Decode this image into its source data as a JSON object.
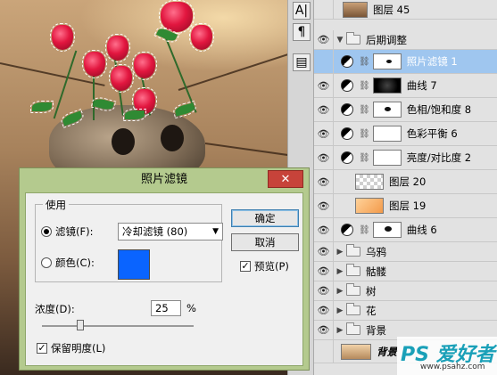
{
  "canvas": {
    "description_color": "#a7825c"
  },
  "toolstrip": {
    "tools": [
      {
        "icon": "char-A-icon",
        "glyph": "A|"
      },
      {
        "icon": "paragraph-icon",
        "glyph": "¶"
      },
      {
        "icon": "panel-icon",
        "glyph": "▤"
      }
    ]
  },
  "layers": {
    "rows": [
      {
        "kind": "layer",
        "name": "图层 45",
        "visible": false
      },
      {
        "kind": "group",
        "name": "后期调整",
        "visible": true,
        "expanded": true
      },
      {
        "kind": "adjustment",
        "name": "照片滤镜 1",
        "visible": false,
        "selected": true,
        "mask": "dark-dot"
      },
      {
        "kind": "adjustment",
        "name": "曲线 7",
        "visible": true,
        "mask": "black"
      },
      {
        "kind": "adjustment",
        "name": "色相/饱和度 8",
        "visible": true,
        "mask": "dark-dot"
      },
      {
        "kind": "adjustment",
        "name": "色彩平衡 6",
        "visible": true,
        "mask": "white"
      },
      {
        "kind": "adjustment",
        "name": "亮度/对比度 2",
        "visible": true,
        "mask": "white"
      },
      {
        "kind": "layer",
        "name": "图层 20",
        "visible": true
      },
      {
        "kind": "layer",
        "name": "图层 19",
        "visible": true
      },
      {
        "kind": "adjustment",
        "name": "曲线 6",
        "visible": true,
        "mask": "dark-dot"
      },
      {
        "kind": "group",
        "name": "乌鸦",
        "visible": true,
        "expanded": false
      },
      {
        "kind": "group",
        "name": "骷髅",
        "visible": true,
        "expanded": false
      },
      {
        "kind": "group",
        "name": "树",
        "visible": true,
        "expanded": false
      },
      {
        "kind": "group",
        "name": "花",
        "visible": true,
        "expanded": false
      },
      {
        "kind": "group",
        "name": "背景",
        "visible": true,
        "expanded": false
      },
      {
        "kind": "layer",
        "name": "背景",
        "visible": false
      }
    ]
  },
  "dialog": {
    "title": "照片滤镜",
    "close_glyph": "✕",
    "use_group": {
      "legend": "使用",
      "filter_label": "滤镜(F):",
      "filter_value": "冷却滤镜 (80)",
      "color_label": "颜色(C):",
      "color_value": "#0a64ff"
    },
    "ok_label": "确定",
    "cancel_label": "取消",
    "preview_label": "预览(P)",
    "preview_checked": true,
    "density_label": "浓度(D):",
    "density_value": "25",
    "density_unit": "%",
    "density_level": 0.25,
    "preserve_label": "保留明度(L)",
    "preserve_checked": true
  },
  "watermark": {
    "main": "PS 爱好者",
    "sub": "www.psahz.com"
  }
}
